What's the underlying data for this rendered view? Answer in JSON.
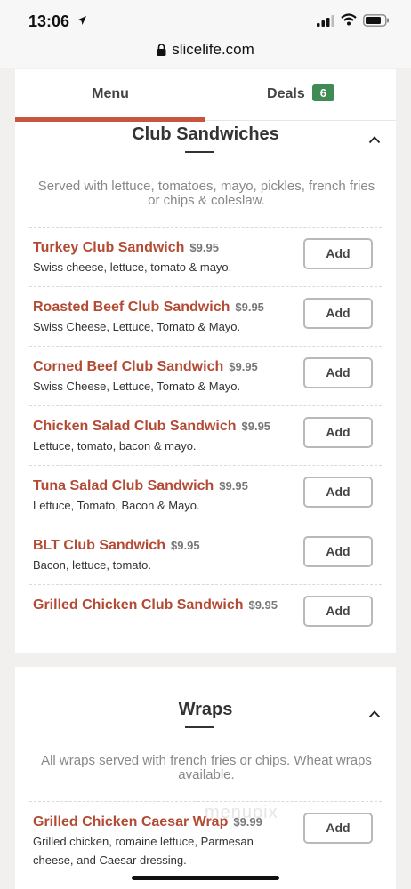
{
  "status_bar": {
    "time": "13:06"
  },
  "browser": {
    "url": "slicelife.com"
  },
  "tabs": [
    {
      "label": "Menu"
    },
    {
      "label": "Deals",
      "badge": "6"
    }
  ],
  "sections": [
    {
      "title": "Club Sandwiches",
      "description": "Served with lettuce, tomatoes, mayo, pickles, french fries or chips & coleslaw.",
      "items": [
        {
          "name": "Turkey Club Sandwich",
          "price": "$9.95",
          "desc": "Swiss cheese, lettuce, tomato & mayo.",
          "add": "Add"
        },
        {
          "name": "Roasted Beef Club Sandwich",
          "price": "$9.95",
          "desc": "Swiss Cheese, Lettuce, Tomato & Mayo.",
          "add": "Add"
        },
        {
          "name": "Corned Beef Club Sandwich",
          "price": "$9.95",
          "desc": "Swiss Cheese, Lettuce, Tomato & Mayo.",
          "add": "Add"
        },
        {
          "name": "Chicken Salad Club Sandwich",
          "price": "$9.95",
          "desc": "Lettuce, tomato, bacon & mayo.",
          "add": "Add"
        },
        {
          "name": "Tuna Salad Club Sandwich",
          "price": "$9.95",
          "desc": "Lettuce, Tomato, Bacon & Mayo.",
          "add": "Add"
        },
        {
          "name": "BLT Club Sandwich",
          "price": "$9.95",
          "desc": "Bacon, lettuce, tomato.",
          "add": "Add"
        },
        {
          "name": "Grilled Chicken Club Sandwich",
          "price": "$9.95",
          "desc": "",
          "add": "Add"
        }
      ]
    },
    {
      "title": "Wraps",
      "description": "All wraps served with french fries or chips. Wheat wraps available.",
      "items": [
        {
          "name": "Grilled Chicken Caesar Wrap",
          "price": "$9.99",
          "desc": "Grilled chicken, romaine lettuce, Parmesan cheese, and Caesar dressing.",
          "add": "Add"
        }
      ]
    }
  ],
  "watermark": "menupix",
  "colors": {
    "accent": "#c8553d",
    "item_name": "#b34a34",
    "badge": "#3f8a55"
  }
}
